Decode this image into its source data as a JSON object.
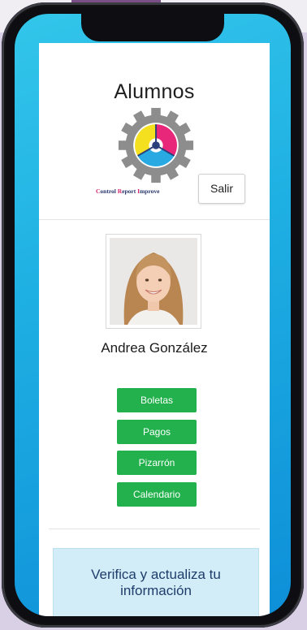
{
  "page": {
    "title": "Alumnos"
  },
  "header": {
    "brand": {
      "c": "C",
      "ontrol": "ontrol ",
      "r": "R",
      "eport": "eport ",
      "i": "I",
      "mprove": "mprove"
    },
    "logout_label": "Salir"
  },
  "student": {
    "name": "Andrea González"
  },
  "menu": {
    "items": [
      {
        "label": "Boletas"
      },
      {
        "label": "Pagos"
      },
      {
        "label": "Pizarrón"
      },
      {
        "label": "Calendario"
      }
    ]
  },
  "verify": {
    "label": "Verifica y actualiza tu información"
  },
  "colors": {
    "accent_green": "#22b14c",
    "screen_blue": "#1fb0e3",
    "verify_bg": "#d2ecf8",
    "brand_magenta": "#d6246b",
    "brand_navy": "#27356b"
  },
  "icons": {
    "logo": "gear-logo-icon",
    "avatar": "student-photo"
  }
}
